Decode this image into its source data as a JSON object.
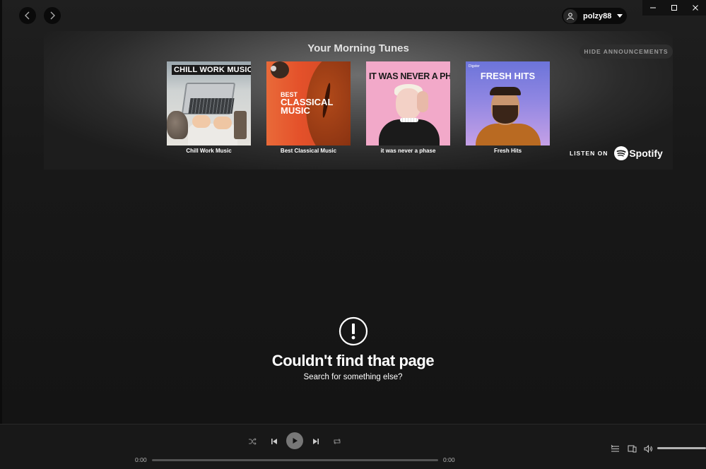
{
  "nav": {
    "back_icon": "chevron-left-icon",
    "forward_icon": "chevron-right-icon"
  },
  "user": {
    "name": "polzy88",
    "avatar_icon": "user-icon",
    "menu_icon": "caret-down-icon"
  },
  "window": {
    "minimize_icon": "minimize-icon",
    "maximize_icon": "maximize-icon",
    "close_icon": "close-icon"
  },
  "banner": {
    "title": "Your Morning Tunes",
    "hide_label": "HIDE ANNOUNCEMENTS",
    "playlists": [
      {
        "label": "Chill Work Music",
        "cover_text": "CHILL WORK MUSIC"
      },
      {
        "label": "Best Classical Music",
        "cover_text_small": "BEST",
        "cover_text_big": "CLASSICAL MUSIC"
      },
      {
        "label": "it was never a phase",
        "cover_text": "IT WAS NEVER A PHASE"
      },
      {
        "label": "Fresh Hits",
        "cover_text": "FRESH HITS",
        "cover_logo": "Digster"
      }
    ],
    "listen_on": "LISTEN ON",
    "brand": "Spotify",
    "brand_icon": "spotify-logo-icon"
  },
  "error": {
    "icon": "exclamation-circle-icon",
    "title": "Couldn't find that page",
    "subtitle": "Search for something else?"
  },
  "player": {
    "time_elapsed": "0:00",
    "time_total": "0:00",
    "progress": 0,
    "volume": 1.0,
    "icons": [
      "shuffle-icon",
      "previous-icon",
      "play-icon",
      "next-icon",
      "repeat-icon",
      "queue-icon",
      "devices-icon",
      "volume-icon"
    ]
  },
  "colors": {
    "background": "#121212",
    "player": "#181818",
    "accent": "#1db954"
  }
}
